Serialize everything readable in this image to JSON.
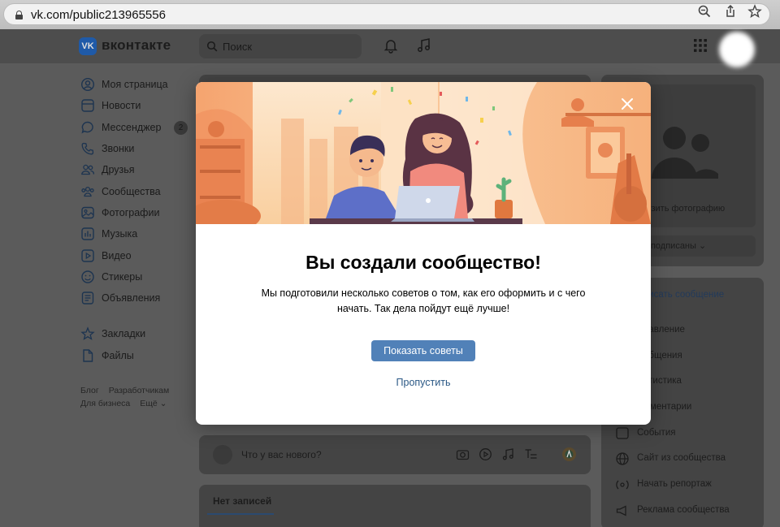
{
  "browser": {
    "url": "vk.com/public213965556",
    "icons": [
      "lock-icon",
      "zoom-icon",
      "share-icon",
      "star-icon"
    ]
  },
  "header": {
    "logo_text": "VK",
    "brand": "вконтакте",
    "search_placeholder": "Поиск",
    "icons": [
      "bell-icon",
      "music-note-icon",
      "apps-grid-icon"
    ]
  },
  "sidebar": {
    "items": [
      {
        "label": "Моя страница",
        "icon": "user-icon"
      },
      {
        "label": "Новости",
        "icon": "news-icon"
      },
      {
        "label": "Мессенджер",
        "icon": "chat-icon",
        "badge": "2"
      },
      {
        "label": "Звонки",
        "icon": "phone-icon"
      },
      {
        "label": "Друзья",
        "icon": "friends-icon"
      },
      {
        "label": "Сообщества",
        "icon": "communities-icon"
      },
      {
        "label": "Фотографии",
        "icon": "photo-icon"
      },
      {
        "label": "Музыка",
        "icon": "music-icon"
      },
      {
        "label": "Видео",
        "icon": "video-icon"
      },
      {
        "label": "Стикеры",
        "icon": "sticker-icon"
      },
      {
        "label": "Объявления",
        "icon": "ads-icon"
      }
    ],
    "items2": [
      {
        "label": "Закладки",
        "icon": "bookmark-icon"
      },
      {
        "label": "Файлы",
        "icon": "file-icon"
      }
    ],
    "footer": {
      "blog": "Блог",
      "developers": "Разработчикам",
      "business": "Для бизнеса",
      "more": "Ещё ⌄"
    }
  },
  "main": {
    "composer_placeholder": "Что у вас нового?",
    "tab_active": "Нет записей"
  },
  "right": {
    "upload_photo": "рузить фотографию",
    "subscribed": "ы подписаны ⌄",
    "write_message": "писать сообщение",
    "menu": [
      "равление",
      "общения",
      "атистика",
      "мментарии",
      "События",
      "Сайт из сообщества",
      "Начать репортаж",
      "Реклама сообщества"
    ]
  },
  "modal": {
    "title": "Вы создали сообщество!",
    "text": "Мы подготовили несколько советов о том, как его оформить и с чего начать. Так дела пойдут ещё лучше!",
    "button": "Показать советы",
    "skip": "Пропустить"
  },
  "colors": {
    "accent": "#5181b8",
    "link": "#2a5885",
    "overlay": "#5b5b5b"
  }
}
